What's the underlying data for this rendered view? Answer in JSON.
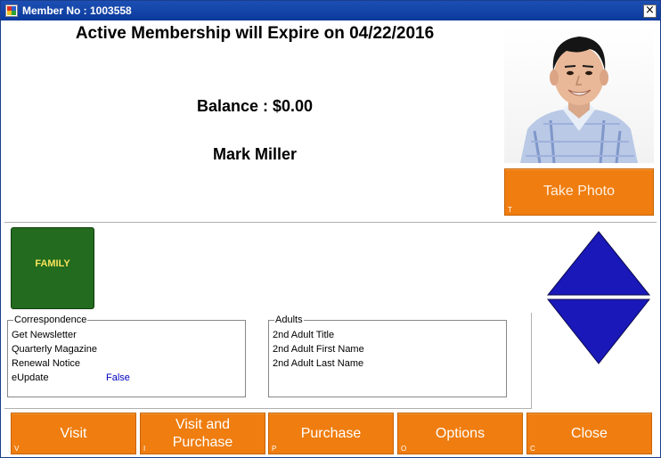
{
  "window": {
    "title": "Member No : 1003558",
    "close_glyph": "×"
  },
  "header": {
    "expiration": "Active Membership will Expire on 04/22/2016",
    "balance": "Balance : $0.00",
    "member_name": "Mark Miller"
  },
  "photo_button": {
    "label": "Take Photo",
    "shortcut": "T"
  },
  "membership_badge": {
    "label": "FAMILY",
    "color": "#236b1e",
    "text_color": "#f5e35c"
  },
  "correspondence": {
    "legend": "Correspondence",
    "rows": [
      {
        "label": "Get Newsletter",
        "value": ""
      },
      {
        "label": "Quarterly Magazine",
        "value": ""
      },
      {
        "label": "Renewal Notice",
        "value": ""
      },
      {
        "label": "eUpdate",
        "value": "False"
      }
    ]
  },
  "adults": {
    "legend": "Adults",
    "rows": [
      "2nd Adult Title",
      "2nd Adult First Name",
      "2nd Adult Last Name"
    ]
  },
  "nav_arrows": {
    "up": "arrow-up-icon",
    "down": "arrow-down-icon",
    "color": "#1a18b8"
  },
  "bottom_buttons": [
    {
      "label": "Visit",
      "shortcut": "V"
    },
    {
      "label": "Visit and Purchase",
      "shortcut": "I"
    },
    {
      "label": "Purchase",
      "shortcut": "P"
    },
    {
      "label": "Options",
      "shortcut": "O"
    },
    {
      "label": "Close",
      "shortcut": "C"
    }
  ],
  "colors": {
    "titlebar": "#0b3a9c",
    "button": "#ef7d0f"
  }
}
